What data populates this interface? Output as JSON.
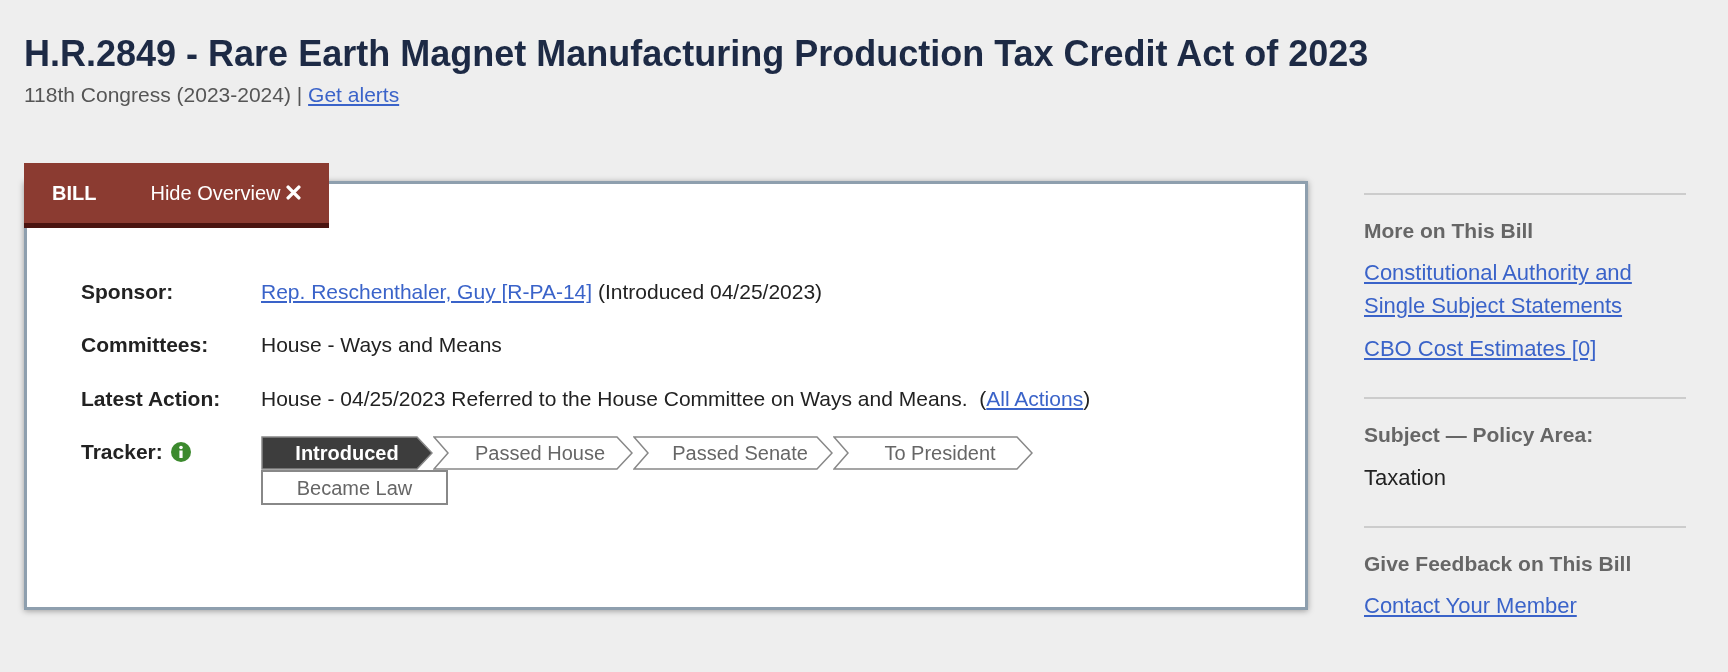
{
  "header": {
    "title": "H.R.2849 - Rare Earth Magnet Manufacturing Production Tax Credit Act of 2023",
    "congress": "118th Congress (2023-2024)",
    "separator": "|",
    "alerts_link": "Get alerts"
  },
  "overview": {
    "tab_label": "BILL",
    "hide_button": "Hide Overview",
    "rows": [
      {
        "label": "Sponsor:",
        "segments": [
          {
            "kind": "link",
            "text": "Rep. Reschenthaler, Guy [R-PA-14]"
          },
          {
            "kind": "text",
            "text": " (Introduced 04/25/2023)"
          }
        ]
      },
      {
        "label": "Committees:",
        "segments": [
          {
            "kind": "text",
            "text": "House - Ways and Means"
          }
        ]
      },
      {
        "label": "Latest Action:",
        "segments": [
          {
            "kind": "text",
            "text": "House - 04/25/2023 Referred to the House Committee on Ways and Means.  ("
          },
          {
            "kind": "link",
            "text": "All Actions"
          },
          {
            "kind": "text",
            "text": ")"
          }
        ]
      }
    ],
    "tracker": {
      "label": "Tracker:",
      "steps": [
        {
          "label": "Introduced",
          "kind": "arrow",
          "selected": true
        },
        {
          "label": "Passed House",
          "kind": "arrow",
          "selected": false
        },
        {
          "label": "Passed Senate",
          "kind": "arrow",
          "selected": false
        },
        {
          "label": "To President",
          "kind": "arrow",
          "selected": false
        },
        {
          "label": "Became Law",
          "kind": "box",
          "selected": false
        }
      ]
    }
  },
  "sidebar": {
    "sections": [
      {
        "heading": "More on This Bill",
        "items": [
          {
            "kind": "link",
            "text": "Constitutional Authority and Single Subject Statements"
          },
          {
            "kind": "link",
            "text": "CBO Cost Estimates [0]"
          }
        ]
      },
      {
        "heading": "Subject — Policy Area:",
        "items": [
          {
            "kind": "text",
            "text": "Taxation"
          }
        ]
      },
      {
        "heading": "Give Feedback on This Bill",
        "items": [
          {
            "kind": "link",
            "text": "Contact Your Member"
          }
        ]
      }
    ]
  }
}
